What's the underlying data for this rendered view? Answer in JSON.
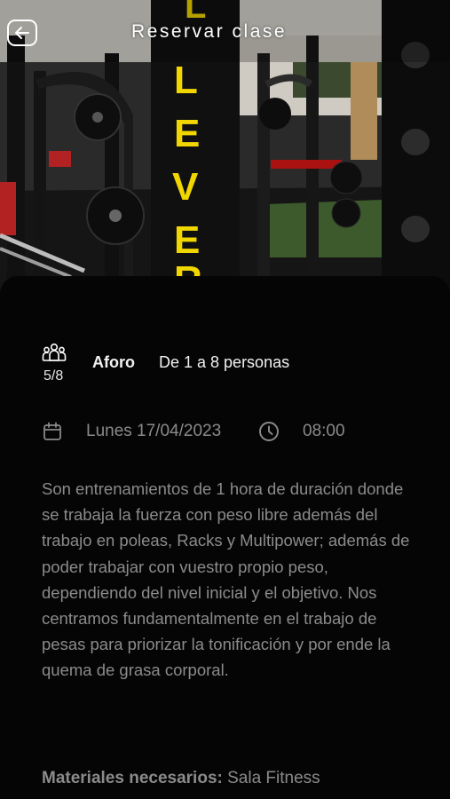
{
  "header": {
    "title": "Reservar clase",
    "back_icon": "arrow-left-icon"
  },
  "hero": {
    "description_icon": "gym-photo",
    "pillar_text": "CLEVER"
  },
  "aforo": {
    "icon": "people-group-icon",
    "count": "5/8",
    "label": "Aforo",
    "value": "De 1 a 8 personas"
  },
  "schedule": {
    "calendar_icon": "calendar-icon",
    "date": "Lunes 17/04/2023",
    "clock_icon": "clock-icon",
    "time": "08:00"
  },
  "description": "Son entrenamientos de 1 hora de duración donde se trabaja la fuerza con peso libre además del trabajo en poleas, Racks y Multipower; además de poder trabajar con vuestro propio peso, dependiendo del nivel inicial y el objetivo. Nos centramos fundamentalmente en el trabajo de pesas para priorizar la tonificación y por ende la quema de grasa corporal.",
  "materials": {
    "label": "Materiales necesarios:",
    "value": "Sala Fitness"
  },
  "colors": {
    "background": "#000000",
    "muted_text": "#8b8b8b",
    "pillar_letters": "#f2d600"
  }
}
